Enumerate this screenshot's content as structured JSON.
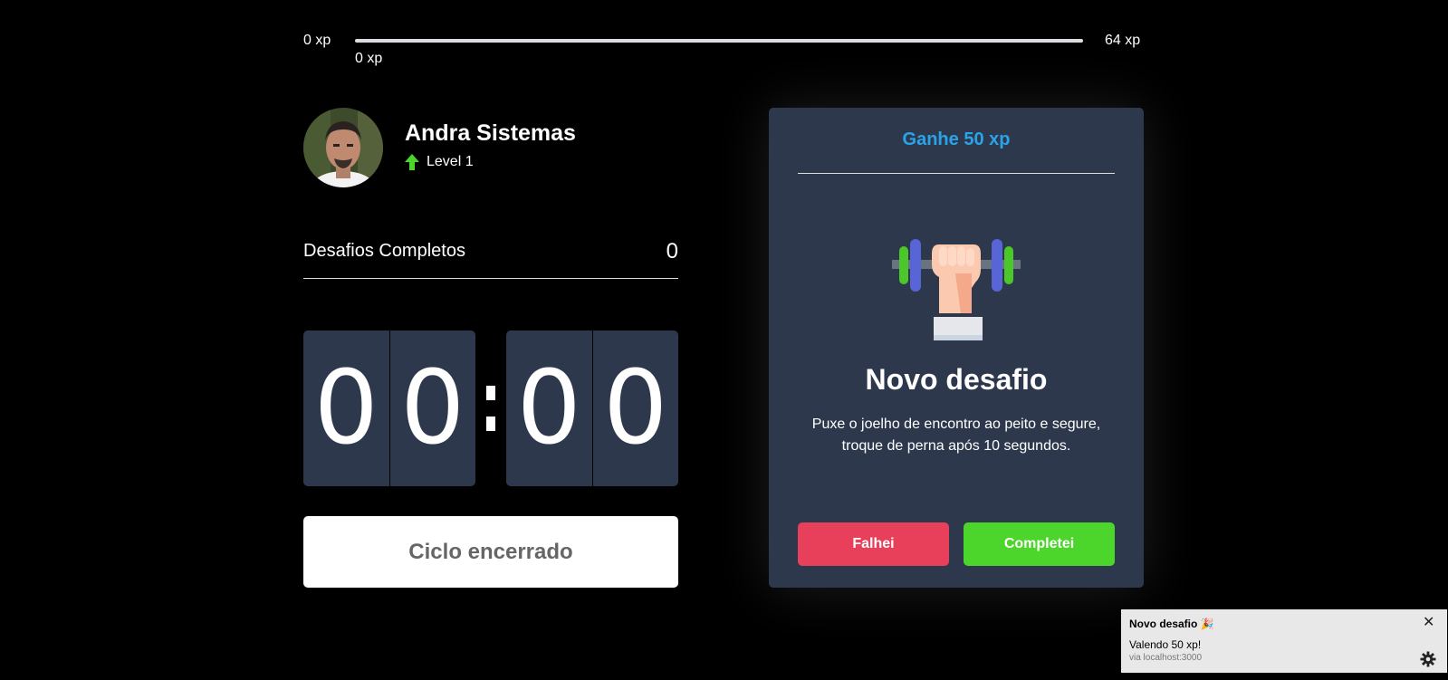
{
  "xp_bar": {
    "min_label": "0 xp",
    "max_label": "64 xp",
    "current_label": "0 xp",
    "progress_fraction": 0,
    "fill_color": "#4cd62b"
  },
  "profile": {
    "name": "Andra Sistemas",
    "level_label": "Level 1",
    "level_icon": "level-up-arrow-icon"
  },
  "completed_challenges": {
    "label": "Desafios Completos",
    "value": "0"
  },
  "countdown": {
    "minutes": [
      "0",
      "0"
    ],
    "seconds": [
      "0",
      "0"
    ]
  },
  "cycle_button": {
    "label": "Ciclo encerrado"
  },
  "challenge_card": {
    "header": "Ganhe 50 xp",
    "image": "dumbbell-icon",
    "title": "Novo desafio",
    "description": "Puxe o joelho de encontro ao peito e segure, troque de perna após 10 segundos.",
    "fail_button": "Falhei",
    "complete_button": "Completei",
    "colors": {
      "accent": "#2aa4e8",
      "fail": "#e83f5b",
      "success": "#4cd62b",
      "card": "#2e384d"
    }
  },
  "notification": {
    "title": "Novo desafio 🎉",
    "body": "Valendo 50 xp!",
    "source": "via localhost:3000",
    "close_icon": "close-icon",
    "settings_icon": "gear-icon"
  }
}
